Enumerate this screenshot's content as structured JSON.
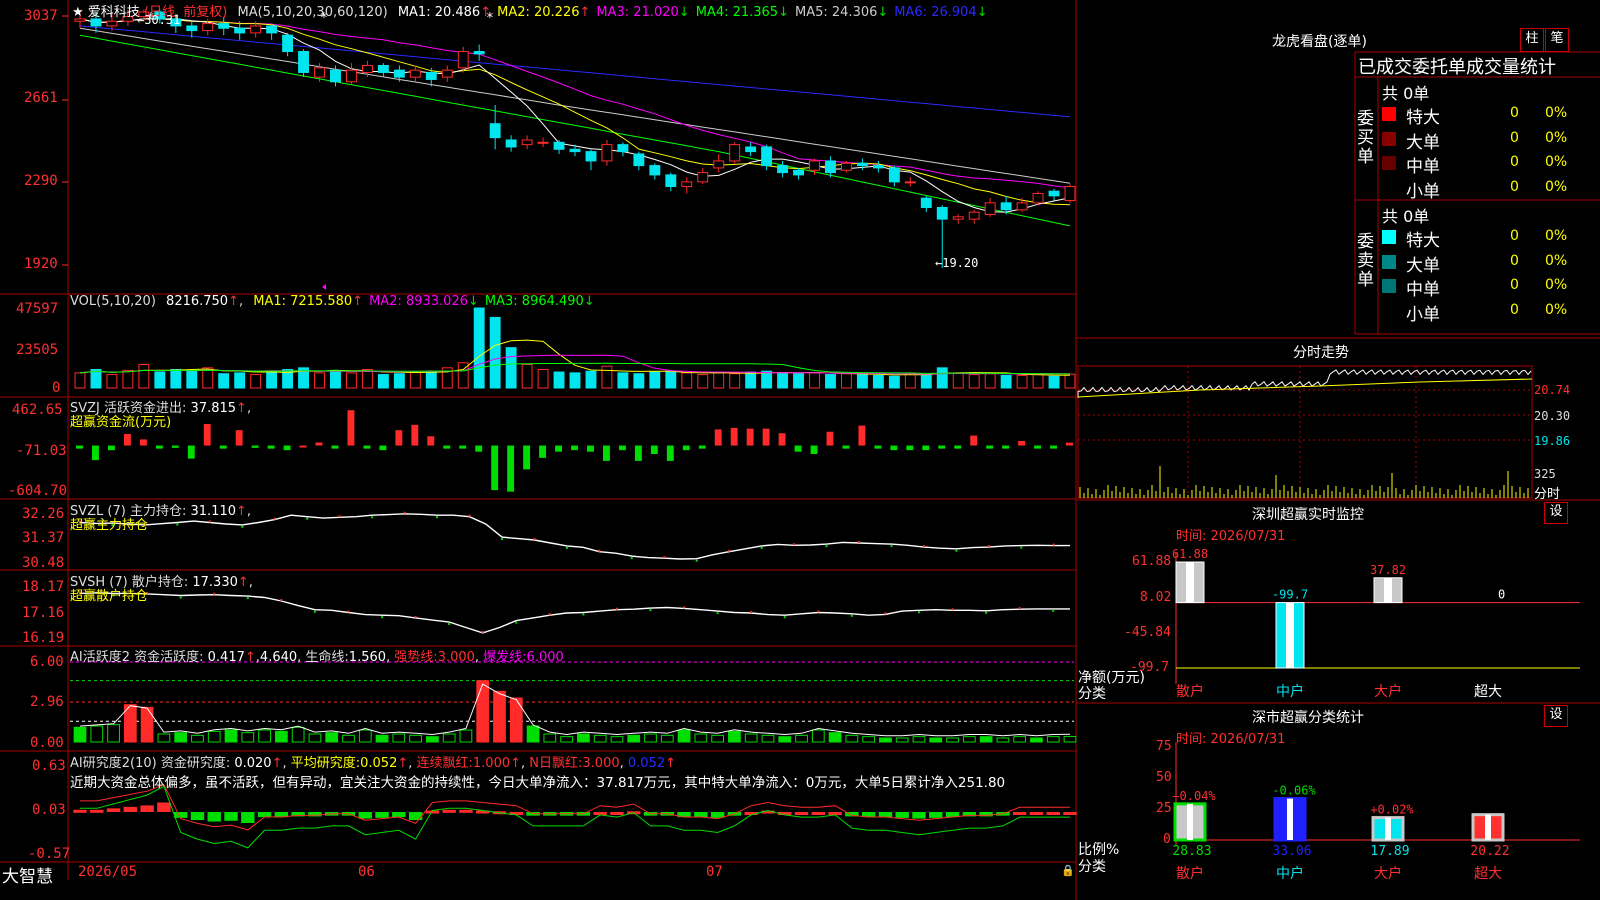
{
  "colors": {
    "bg": "#000000",
    "frame": "#aa0000",
    "up": "#ff2a2a",
    "down": "#00e5ee",
    "ma1": "#ffffff",
    "ma2": "#ffff00",
    "ma3": "#ff00ff",
    "ma4": "#00ff00",
    "ma5": "#aaaaaa",
    "ma6": "#1010dd",
    "green": "#00dd00",
    "label": "#ff3030"
  },
  "stock": {
    "name": "★ 爱科科技",
    "mode": "(日线, 前复权)",
    "ma_title": "MA(5,10,20,30,60,120)",
    "ma": [
      {
        "label": "MA1:",
        "value": "20.486",
        "arrow": "↑",
        "color": "#ffffff"
      },
      {
        "label": "MA2:",
        "value": "20.226",
        "arrow": "↑",
        "color": "#ffff00"
      },
      {
        "label": "MA3:",
        "value": "21.020",
        "arrow": "↓",
        "color": "#ff00ff"
      },
      {
        "label": "MA4:",
        "value": "21.365",
        "arrow": "↓",
        "color": "#00ff00"
      },
      {
        "label": "MA5:",
        "value": "24.306",
        "arrow": "↓",
        "color": "#cccccc"
      },
      {
        "label": "MA6:",
        "value": "26.904",
        "arrow": "↓",
        "color": "#2a2aff"
      }
    ],
    "y_ticks": [
      "3037",
      "2661",
      "2290",
      "1920"
    ],
    "high_label": "30.31",
    "low_label": "19.20"
  },
  "vol": {
    "title": "VOL(5,10,20)",
    "value": "8216.750",
    "arrow": "↑",
    "ma": [
      {
        "label": "MA1:",
        "value": "7215.580",
        "arrow": "↑",
        "color": "#ffff00"
      },
      {
        "label": "MA2:",
        "value": "8933.026",
        "arrow": "↓",
        "color": "#ff00ff"
      },
      {
        "label": "MA3:",
        "value": "8964.490",
        "arrow": "↓",
        "color": "#00ff00"
      }
    ],
    "y_ticks": [
      "47597",
      "23505",
      "0"
    ]
  },
  "svzj": {
    "title": "SVZJ  活跃资金进出:",
    "value": "37.815",
    "arrow": "↑",
    "tail": ",",
    "subtitle": "超赢资金流(万元)",
    "y_ticks": [
      "462.65",
      "-71.03",
      "-604.70"
    ]
  },
  "svzl": {
    "title": "SVZL  (7) 主力持仓:",
    "value": "31.110",
    "arrow": "↑",
    "tail": ",",
    "subtitle": "超赢主力持仓",
    "y_ticks": [
      "32.26",
      "31.37",
      "30.48"
    ]
  },
  "svsh": {
    "title": "SVSH  (7) 散户持仓:",
    "value": "17.330",
    "arrow": "↑",
    "tail": ",",
    "subtitle": "超赢散户持仓",
    "y_ticks": [
      "18.17",
      "17.16",
      "16.19"
    ]
  },
  "ai1": {
    "title": "AI活跃度2 资金活跃度:",
    "v1": "0.417",
    "a1": "↑",
    "v2": "4.640",
    "life": "生命线:",
    "life_v": "1.560",
    "strong": "强势线:",
    "strong_v": "3.000",
    "burst": "爆发线:",
    "burst_v": "6.000",
    "y_ticks": [
      "6.00",
      "2.96",
      "0.00"
    ]
  },
  "ai2": {
    "title": "AI研究度2(10) 资金研究度:",
    "v1": "0.020",
    "a1": "↑",
    "avg": "平均研究度:",
    "avg_v": "0.052",
    "a2": "↑",
    "red": "连续飘红:",
    "red_v": "1.000",
    "a3": "↑",
    "nred": "N日飘红:",
    "nred_v1": "3.000",
    "nred_v2": "0.052",
    "a4": "↑",
    "comment": "近期大资金总体偏多，虽不活跃，但有异动，宜关注大资金的持续性，今日大单净流入：37.817万元，其中特大单净流入：0万元，大单5日累计净入251.80",
    "y_ticks": [
      "0.63",
      "0.03",
      "-0.57"
    ]
  },
  "bottom": {
    "brand": "大智慧",
    "dates": [
      "2026/05",
      "06",
      "07"
    ]
  },
  "right": {
    "dragon_title": "龙虎看盘(逐单)",
    "tab_zhu": "柱",
    "tab_bi": "笔",
    "stat_title": "已成交委托单成交量统计",
    "buy_side": "委买单",
    "sell_side": "委卖单",
    "buy_total": "共 0单",
    "sell_total": "共 0单",
    "buy_rows": [
      {
        "label": "特大",
        "count": "0",
        "pct": "0%",
        "color": "#ff0000"
      },
      {
        "label": "大单",
        "count": "0",
        "pct": "0%",
        "color": "#880000"
      },
      {
        "label": "中单",
        "count": "0",
        "pct": "0%",
        "color": "#660000"
      },
      {
        "label": "小单",
        "count": "0",
        "pct": "0%",
        "color": ""
      }
    ],
    "sell_rows": [
      {
        "label": "特大",
        "count": "0",
        "pct": "0%",
        "color": "#00ffff"
      },
      {
        "label": "大单",
        "count": "0",
        "pct": "0%",
        "color": "#008888"
      },
      {
        "label": "中单",
        "count": "0",
        "pct": "0%",
        "color": "#007777"
      },
      {
        "label": "小单",
        "count": "0",
        "pct": "0%",
        "color": ""
      }
    ],
    "fenshi_title": "分时走势",
    "fenshi_prices": [
      "20.74",
      "20.30",
      "19.86"
    ],
    "fenshi_vol": "325",
    "fenshi_unit": "分时",
    "monitor_title": "深圳超赢实时监控",
    "monitor_set": "设",
    "monitor_time": "时间: 2026/07/31",
    "monitor_y": [
      "61.88",
      "8.02",
      "-45.84",
      "-99.7"
    ],
    "monitor_ylabel": "净额(万元)",
    "monitor_xlabel": "分类",
    "cls_title": "深市超赢分类统计",
    "cls_set": "设",
    "cls_time": "时间: 2026/07/31",
    "cls_y": [
      "75",
      "50",
      "25",
      "0"
    ],
    "cls_ylabel": "比例%",
    "cls_xlabel": "分类"
  },
  "chart_data": [
    {
      "type": "candlestick",
      "title": "爱科科技 日线",
      "x_range": [
        "2026/05",
        "2026/07"
      ],
      "ylim": [
        19.2,
        30.37
      ],
      "candles": [
        [
          29.8,
          29.9,
          30.3,
          29.5
        ],
        [
          29.9,
          29.6,
          30.2,
          29.3
        ],
        [
          29.6,
          29.8,
          30.1,
          29.4
        ],
        [
          29.8,
          30.0,
          30.3,
          29.6
        ],
        [
          30.0,
          30.2,
          30.31,
          29.8
        ],
        [
          30.2,
          29.9,
          30.3,
          29.7
        ],
        [
          29.9,
          29.6,
          30.1,
          29.3
        ],
        [
          29.6,
          29.4,
          29.8,
          29.1
        ],
        [
          29.4,
          29.7,
          29.9,
          29.2
        ],
        [
          29.7,
          29.5,
          30.0,
          29.2
        ],
        [
          29.5,
          29.3,
          29.8,
          29.0
        ],
        [
          29.3,
          29.6,
          29.8,
          29.1
        ],
        [
          29.6,
          29.3,
          29.7,
          29.0
        ],
        [
          29.2,
          28.5,
          29.3,
          28.3
        ],
        [
          28.5,
          27.6,
          28.6,
          27.4
        ],
        [
          27.4,
          27.8,
          28.0,
          27.2
        ],
        [
          27.7,
          27.2,
          27.9,
          27.0
        ],
        [
          27.2,
          27.7,
          28.0,
          27.1
        ],
        [
          27.6,
          27.9,
          28.1,
          27.4
        ],
        [
          27.9,
          27.6,
          28.0,
          27.4
        ],
        [
          27.7,
          27.4,
          27.9,
          27.2
        ],
        [
          27.4,
          27.7,
          27.9,
          27.2
        ],
        [
          27.6,
          27.3,
          27.8,
          27.0
        ],
        [
          27.4,
          27.7,
          27.9,
          27.2
        ],
        [
          27.8,
          28.5,
          28.7,
          27.6
        ],
        [
          28.5,
          28.4,
          28.8,
          28.1
        ],
        [
          25.4,
          24.8,
          26.2,
          24.3
        ],
        [
          24.7,
          24.4,
          24.9,
          24.2
        ],
        [
          24.5,
          24.7,
          24.9,
          24.3
        ],
        [
          24.6,
          24.6,
          24.8,
          24.4
        ],
        [
          24.6,
          24.3,
          24.7,
          24.1
        ],
        [
          24.3,
          24.2,
          24.5,
          24.0
        ],
        [
          24.2,
          23.8,
          24.3,
          23.4
        ],
        [
          23.8,
          24.5,
          24.7,
          23.6
        ],
        [
          24.5,
          24.2,
          24.6,
          24.0
        ],
        [
          24.1,
          23.6,
          24.2,
          23.4
        ],
        [
          23.6,
          23.2,
          23.7,
          23.0
        ],
        [
          23.2,
          22.7,
          23.3,
          22.5
        ],
        [
          22.7,
          22.9,
          23.1,
          22.4
        ],
        [
          22.9,
          23.3,
          23.5,
          22.8
        ],
        [
          23.5,
          23.8,
          24.1,
          23.3
        ],
        [
          23.8,
          24.5,
          24.6,
          23.7
        ],
        [
          24.4,
          24.2,
          24.6,
          24.0
        ],
        [
          24.4,
          23.6,
          24.5,
          23.4
        ],
        [
          23.6,
          23.3,
          23.8,
          23.1
        ],
        [
          23.4,
          23.2,
          23.5,
          23.0
        ],
        [
          23.4,
          23.8,
          23.9,
          23.2
        ],
        [
          23.8,
          23.3,
          24.0,
          23.1
        ],
        [
          23.4,
          23.7,
          23.8,
          23.3
        ],
        [
          23.7,
          23.6,
          23.9,
          23.4
        ],
        [
          23.6,
          23.5,
          23.8,
          23.3
        ],
        [
          23.5,
          22.9,
          23.6,
          22.7
        ],
        [
          22.9,
          22.9,
          23.1,
          22.7
        ],
        [
          22.2,
          21.8,
          22.3,
          21.6
        ],
        [
          21.8,
          21.3,
          21.9,
          19.2
        ],
        [
          21.3,
          21.4,
          21.5,
          21.1
        ],
        [
          21.3,
          21.6,
          21.7,
          21.1
        ],
        [
          21.5,
          22.0,
          22.2,
          21.4
        ],
        [
          22.0,
          21.7,
          22.3,
          21.5
        ],
        [
          21.7,
          22.0,
          22.2,
          21.6
        ],
        [
          22.0,
          22.4,
          22.5,
          21.9
        ],
        [
          22.5,
          22.3,
          22.6,
          22.1
        ],
        [
          22.1,
          22.7,
          22.8,
          22.0
        ]
      ]
    },
    {
      "type": "bar",
      "title": "VOL(5,10,20)",
      "ylim": [
        0,
        47597
      ],
      "values": [
        9000,
        11000,
        8000,
        10500,
        14000,
        9500,
        11000,
        10000,
        12000,
        8500,
        9000,
        8000,
        10000,
        11000,
        12000,
        9000,
        10500,
        9000,
        11000,
        8000,
        8500,
        9500,
        10000,
        12000,
        15000,
        47597,
        42000,
        24000,
        14000,
        11000,
        9500,
        9000,
        10000,
        13000,
        9000,
        8500,
        9500,
        10000,
        9000,
        8000,
        9000,
        8500,
        9500,
        10000,
        9000,
        8500,
        9000,
        8000,
        8500,
        8000,
        7500,
        7000,
        9000,
        8000,
        12000,
        9000,
        8000,
        8500,
        7500,
        7500,
        8000,
        7000,
        8216.75
      ]
    },
    {
      "type": "bar",
      "title": "SVZJ 活跃资金进出",
      "ylim": [
        -604.7,
        462.65
      ],
      "values": [
        -40,
        -190,
        -60,
        150,
        80,
        -40,
        -30,
        -170,
        280,
        -40,
        200,
        -30,
        -40,
        -60,
        0,
        40,
        -40,
        460,
        -40,
        -60,
        200,
        270,
        120,
        -40,
        -40,
        -80,
        -580,
        -600,
        -310,
        -160,
        -80,
        -60,
        -80,
        -200,
        -60,
        -200,
        -110,
        -200,
        -60,
        -40,
        210,
        230,
        220,
        220,
        160,
        -80,
        -110,
        180,
        -40,
        260,
        -40,
        -60,
        -60,
        -60,
        -40,
        -40,
        130,
        -40,
        -40,
        60,
        -40,
        -40,
        37.8
      ]
    },
    {
      "type": "line",
      "title": "SVZL 主力持仓",
      "ylim": [
        30.48,
        32.26
      ],
      "values": [
        31.9,
        31.87,
        31.88,
        31.85,
        31.82,
        31.86,
        31.9,
        31.95,
        31.9,
        31.85,
        31.82,
        31.9,
        32.0,
        32.15,
        32.1,
        32.05,
        32.08,
        32.1,
        32.15,
        32.17,
        32.2,
        32.18,
        32.15,
        32.15,
        32.1,
        31.85,
        31.4,
        31.35,
        31.3,
        31.2,
        31.1,
        31.05,
        30.9,
        30.85,
        30.75,
        30.7,
        30.68,
        30.65,
        30.66,
        30.8,
        30.9,
        31.0,
        31.1,
        31.15,
        31.12,
        31.13,
        31.16,
        31.22,
        31.2,
        31.18,
        31.16,
        31.12,
        31.06,
        31.02,
        31.0,
        31.04,
        31.06,
        31.1,
        31.11,
        31.12,
        31.11,
        31.11
      ]
    },
    {
      "type": "line",
      "title": "SVSH 散户持仓",
      "ylim": [
        16.19,
        18.17
      ],
      "values": [
        17.9,
        17.92,
        17.9,
        17.9,
        17.88,
        17.85,
        17.82,
        17.84,
        17.85,
        17.82,
        17.8,
        17.75,
        17.62,
        17.45,
        17.3,
        17.28,
        17.2,
        17.12,
        17.1,
        17.08,
        17.0,
        16.92,
        16.85,
        16.65,
        16.45,
        16.65,
        16.9,
        17.0,
        17.1,
        17.18,
        17.2,
        17.25,
        17.3,
        17.32,
        17.36,
        17.38,
        17.35,
        17.3,
        17.25,
        17.2,
        17.18,
        17.12,
        17.1,
        17.15,
        17.2,
        17.18,
        17.15,
        17.1,
        17.13,
        17.25,
        17.28,
        17.3,
        17.28,
        17.28,
        17.26,
        17.3,
        17.32,
        17.33,
        17.33,
        17.33
      ]
    },
    {
      "type": "bar",
      "title": "AI活跃度2 资金活跃度",
      "ylim": [
        0,
        6.0
      ],
      "reference_lines": [
        {
          "name": "生命线",
          "value": 1.56
        },
        {
          "name": "强势线",
          "value": 3.0
        },
        {
          "name": "爆发线",
          "value": 6.0
        }
      ],
      "values": [
        1.1,
        1.2,
        1.3,
        2.8,
        2.6,
        0.6,
        0.7,
        0.5,
        0.8,
        0.9,
        0.7,
        0.9,
        0.8,
        1.1,
        0.6,
        0.7,
        0.5,
        0.9,
        0.5,
        0.6,
        0.5,
        0.4,
        0.6,
        0.9,
        4.6,
        3.8,
        3.3,
        1.2,
        0.6,
        0.4,
        0.6,
        0.5,
        0.4,
        0.5,
        0.6,
        0.5,
        0.9,
        0.6,
        0.5,
        0.8,
        0.6,
        0.5,
        0.4,
        0.5,
        0.9,
        0.7,
        0.5,
        0.4,
        0.3,
        0.3,
        0.4,
        0.3,
        0.3,
        0.4,
        0.4,
        0.3,
        0.4,
        0.3,
        0.4,
        0.417
      ]
    },
    {
      "type": "bar",
      "title": "AI研究度2(10) 资金研究度",
      "ylim": [
        -0.57,
        0.63
      ],
      "values": [
        0.06,
        0.06,
        0.08,
        0.1,
        0.12,
        0.16,
        -0.05,
        -0.08,
        -0.1,
        -0.09,
        -0.12,
        -0.04,
        -0.04,
        -0.03,
        -0.03,
        -0.02,
        -0.02,
        -0.06,
        -0.05,
        -0.04,
        -0.08,
        0.05,
        0.06,
        0.06,
        0.05,
        0.04,
        0.03,
        -0.02,
        -0.02,
        -0.02,
        -0.02,
        0.03,
        0.02,
        0.04,
        -0.02,
        -0.02,
        -0.04,
        -0.04,
        -0.05,
        -0.02,
        0.03,
        0.05,
        0.03,
        0.02,
        0.02,
        0.03,
        -0.03,
        -0.04,
        -0.04,
        -0.05,
        -0.06,
        -0.05,
        -0.04,
        -0.03,
        -0.03,
        -0.02,
        0.02,
        0.02,
        0.02,
        0.02
      ]
    },
    {
      "type": "bar",
      "title": "深圳超赢实时监控",
      "categories": [
        "散户",
        "中户",
        "大户",
        "超大"
      ],
      "values": [
        61.88,
        -99.7,
        37.82,
        0
      ],
      "ylim": [
        -99.7,
        61.88
      ]
    },
    {
      "type": "bar",
      "title": "深市超赢分类统计",
      "categories": [
        "散户",
        "中户",
        "大户",
        "超大"
      ],
      "values": [
        28.83,
        33.06,
        17.89,
        20.22
      ],
      "changes": [
        "+0.04%",
        "-0.06%",
        "+0.02%",
        ""
      ],
      "ylim": [
        0,
        75
      ]
    }
  ]
}
